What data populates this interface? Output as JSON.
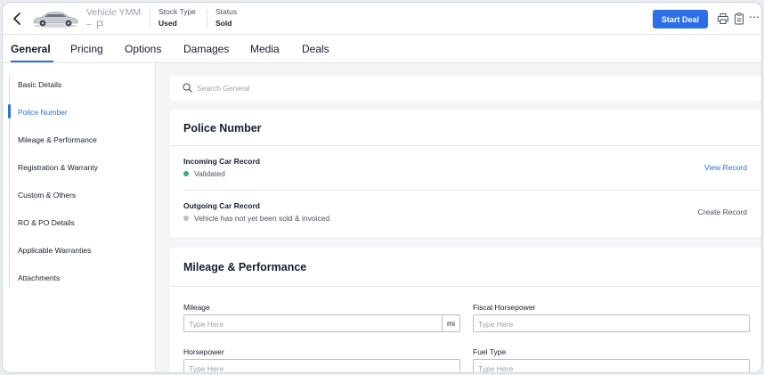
{
  "header": {
    "vehicle_title": "Vehicle YMM",
    "vehicle_subtitle": "–",
    "stock_type_label": "Stock Type",
    "stock_type_value": "Used",
    "status_label": "Status",
    "status_value": "Sold",
    "start_deal_label": "Start Deal",
    "more_icon": "⋯"
  },
  "tabs": [
    {
      "label": "General",
      "active": true
    },
    {
      "label": "Pricing"
    },
    {
      "label": "Options"
    },
    {
      "label": "Damages"
    },
    {
      "label": "Media"
    },
    {
      "label": "Deals"
    }
  ],
  "sidebar": {
    "items": [
      {
        "label": "Basic Details"
      },
      {
        "label": "Police Number",
        "active": true
      },
      {
        "label": "Mileage & Performance"
      },
      {
        "label": "Registration & Warranty"
      },
      {
        "label": "Custom & Others"
      },
      {
        "label": "RO & PO Details"
      },
      {
        "label": "Applicable Warranties"
      },
      {
        "label": "Attachments"
      }
    ]
  },
  "search": {
    "placeholder": "Search General"
  },
  "police_number": {
    "title": "Police Number",
    "incoming": {
      "title": "Incoming Car Record",
      "status": "Validated",
      "status_color": "#2bb673",
      "action": "View Record"
    },
    "outgoing": {
      "title": "Outgoing Car Record",
      "status": "Vehicle has not yet been sold & invoiced",
      "status_color": "#b8c0cc",
      "action": "Create Record"
    }
  },
  "mileage": {
    "title": "Mileage & Performance",
    "fields": [
      {
        "label": "Mileage",
        "placeholder": "Type Here",
        "unit": "mi"
      },
      {
        "label": "Fiscal Horsepower",
        "placeholder": "Type Here"
      },
      {
        "label": "Horsepower",
        "placeholder": "Type Here"
      },
      {
        "label": "Fuel Type",
        "placeholder": "Type Here"
      }
    ]
  },
  "colors": {
    "accent": "#2b6ee8",
    "validated": "#2bb673",
    "pending": "#b8c0cc"
  }
}
